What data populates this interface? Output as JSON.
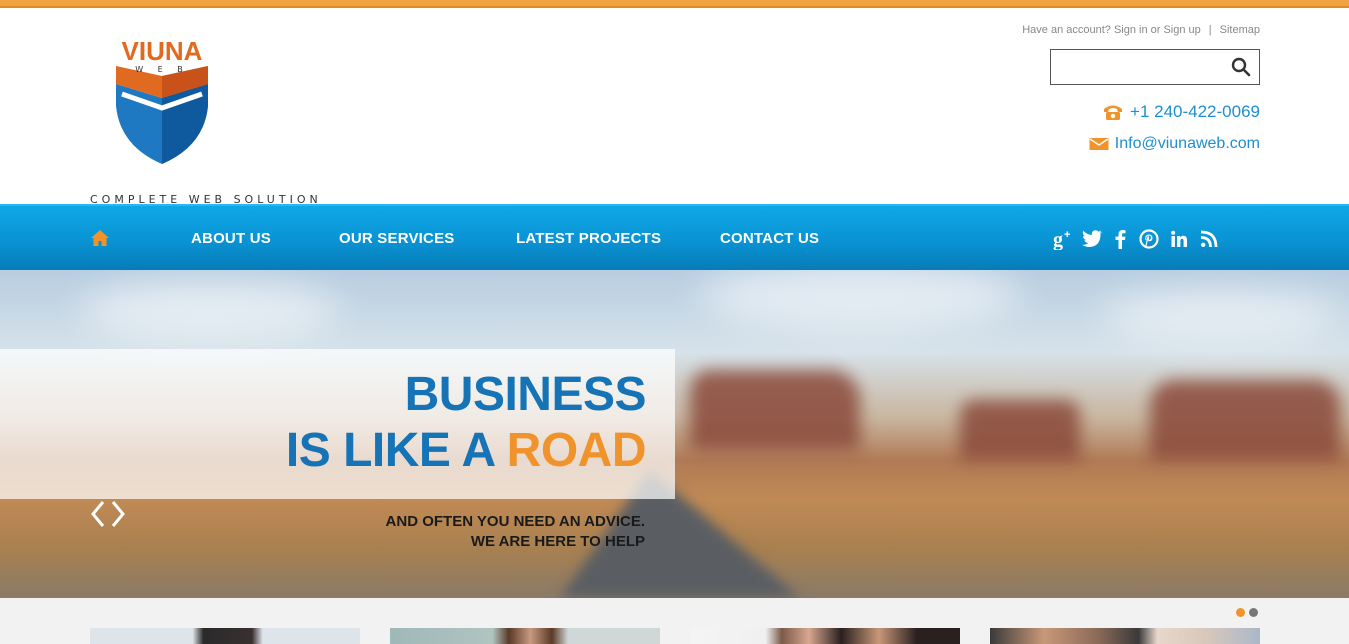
{
  "brand": {
    "name": "VIUNA",
    "sub": "W E B",
    "tagline": "COMPLETE WEB SOLUTION",
    "colors": {
      "orange": "#f0932b",
      "blue": "#1573b6",
      "nav": "#0a93d3"
    }
  },
  "account": {
    "text": "Have an account? Sign in or Sign up",
    "separator": "|",
    "sitemap": "Sitemap"
  },
  "search": {
    "placeholder": "",
    "icon": "search-icon"
  },
  "contact": {
    "phone": "+1 240-422-0069",
    "email": "Info@viunaweb.com"
  },
  "nav": {
    "home_icon": "home-icon",
    "items": [
      "ABOUT US",
      "OUR SERVICES",
      "LATEST PROJECTS",
      "CONTACT US"
    ],
    "social": [
      "google-plus-icon",
      "twitter-icon",
      "facebook-icon",
      "pinterest-icon",
      "linkedin-icon",
      "rss-icon"
    ]
  },
  "hero": {
    "line1": "BUSINESS",
    "line2_start": "IS LIKE A ",
    "line2_accent": "ROAD",
    "sub1": "AND OFTEN YOU NEED AN ADVICE.",
    "sub2": "WE ARE HERE TO HELP"
  },
  "slider": {
    "active_slide": 1,
    "total_slides": 2
  }
}
